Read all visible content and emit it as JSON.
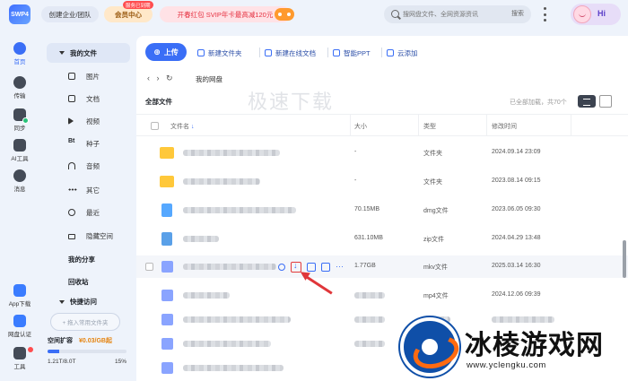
{
  "topbar": {
    "logo_text": "SWP4",
    "enterprise_label": "创建企业/团队",
    "vip_label": "会员中心",
    "vip_badge": "服务已到期",
    "promo_label": "开春红包 SVIP年卡最高减120元",
    "search_placeholder": "搜网盘文件、全网资源资讯",
    "search_button": "搜索",
    "hi_label": "Hi"
  },
  "rail": {
    "items": [
      {
        "label": "首页",
        "icon": "home-icon"
      },
      {
        "label": "传输",
        "icon": "transfer-icon"
      },
      {
        "label": "同步",
        "icon": "sync-icon"
      },
      {
        "label": "AI工具",
        "icon": "ai-tools-icon"
      },
      {
        "label": "消息",
        "icon": "message-icon"
      },
      {
        "label": "App下载",
        "icon": "app-download-icon"
      },
      {
        "label": "网盘认证",
        "icon": "certify-icon"
      },
      {
        "label": "工具",
        "icon": "tools-icon"
      }
    ]
  },
  "sidebar": {
    "my_files": "我的文件",
    "items": [
      {
        "label": "图片",
        "icon": "image-icon"
      },
      {
        "label": "文档",
        "icon": "document-icon"
      },
      {
        "label": "视频",
        "icon": "video-icon"
      },
      {
        "label": "种子",
        "icon": "bt-icon"
      },
      {
        "label": "音频",
        "icon": "audio-icon"
      },
      {
        "label": "其它",
        "icon": "other-icon"
      },
      {
        "label": "最近",
        "icon": "recent-icon"
      },
      {
        "label": "隐藏空间",
        "icon": "lock-icon"
      }
    ],
    "my_share": "我的分享",
    "recycle": "回收站",
    "quick_access": "快捷访问",
    "add_quick": "+ 拖入常用文件夹",
    "space_title": "空间扩容",
    "space_promo": "¥0.03/GB起",
    "space_used": "1.21T/8.0T",
    "space_pct": "15%",
    "space_fraction": 0.15
  },
  "toolbar": {
    "upload": "上传",
    "new_folder": "新建文件夹",
    "new_online_doc": "新建在线文档",
    "smart_ppt": "智能PPT",
    "cloud_add": "云添加"
  },
  "breadcrumb": {
    "current": "我的网盘"
  },
  "overlay_watermark": "极速下载",
  "list": {
    "title": "全部文件",
    "loaded_text": "已全部加载，共70个",
    "columns": {
      "name": "文件名",
      "size": "大小",
      "type": "类型",
      "mtime": "修改时间"
    },
    "rows": [
      {
        "icon": "folder",
        "size": "-",
        "type": "文件夹",
        "mtime": "2024.09.14 23:09"
      },
      {
        "icon": "folder",
        "size": "-",
        "type": "文件夹",
        "mtime": "2023.08.14 09:15"
      },
      {
        "icon": "dmg",
        "size": "70.15MB",
        "type": "dmg文件",
        "mtime": "2023.06.05 09:30"
      },
      {
        "icon": "zip",
        "size": "631.10MB",
        "type": "zip文件",
        "mtime": "2024.04.29 13:48"
      },
      {
        "icon": "video",
        "size": "1.77GB",
        "type": "mkv文件",
        "mtime": "2025.03.14 16:30"
      },
      {
        "icon": "video",
        "size": "",
        "type": "mp4文件",
        "mtime": "2024.12.06 09:39"
      },
      {
        "icon": "video",
        "size": "",
        "type": "",
        "mtime": ""
      },
      {
        "icon": "video",
        "size": "",
        "type": "",
        "mtime": ""
      },
      {
        "icon": "video",
        "size": "",
        "type": "",
        "mtime": ""
      }
    ]
  },
  "site_watermark": {
    "name": "冰棱游戏网",
    "url": "www.yclengku.com"
  },
  "colors": {
    "accent": "#3a6ef6",
    "folder": "#ffc83a",
    "highlight_box": "#e23a3a"
  }
}
